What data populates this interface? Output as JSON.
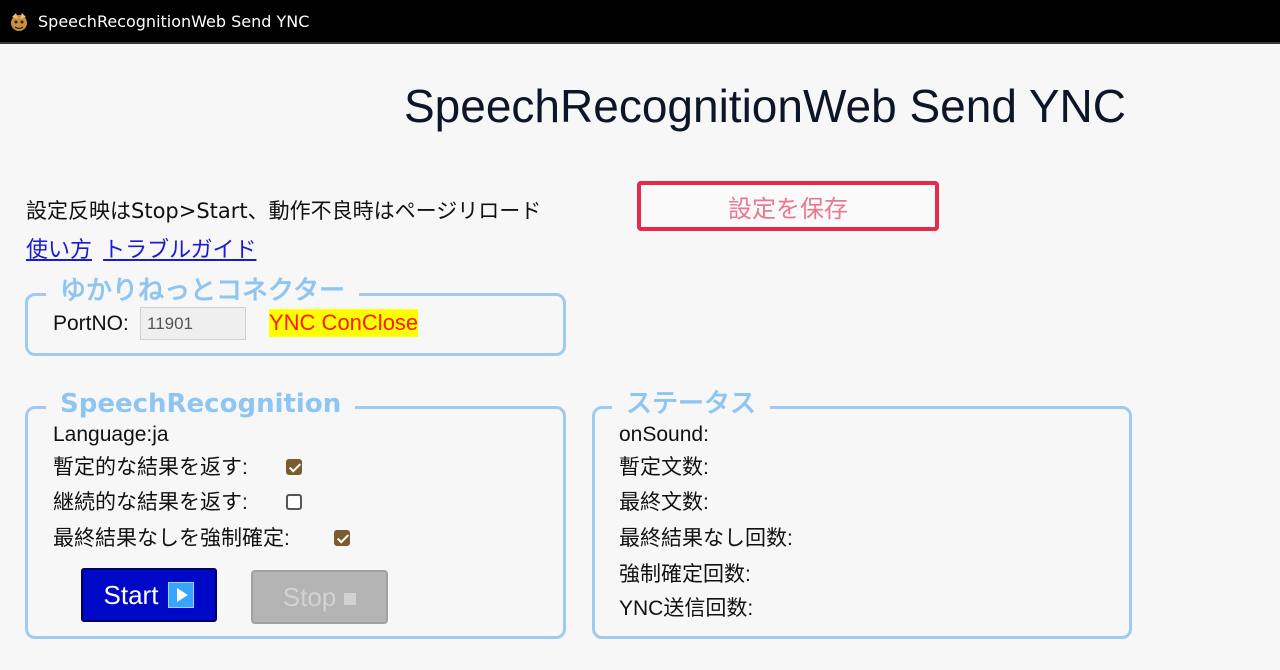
{
  "window": {
    "title": "SpeechRecognitionWeb Send YNC",
    "icon": "app-icon"
  },
  "page": {
    "title": "SpeechRecognitionWeb Send YNC",
    "notice": "設定反映はStop>Start、動作不良時はページリロード",
    "save_label": "設定を保存",
    "links": [
      "使い方",
      "トラブルガイド"
    ]
  },
  "ync": {
    "legend": "ゆかりねっとコネクター",
    "port_label": "PortNO:",
    "port_value": "11901",
    "connection_status": "YNC ConClose"
  },
  "speech": {
    "legend": "SpeechRecognition",
    "language": "Language:ja",
    "options": [
      {
        "label": "暫定的な結果を返す:",
        "checked": true
      },
      {
        "label": "継続的な結果を返す:",
        "checked": false
      },
      {
        "label": "最終結果なしを強制確定:",
        "checked": true
      }
    ],
    "start_label": "Start",
    "stop_label": "Stop"
  },
  "status": {
    "legend": "ステータス",
    "items": [
      "onSound:",
      "暫定文数:",
      "最終文数:",
      "最終結果なし回数:",
      "強制確定回数:",
      "YNC送信回数:"
    ]
  },
  "colors": {
    "save_border": "#e52a4c",
    "panel_border": "#9ecbf2",
    "legend_text": "#8ec5f2",
    "start_bg": "#0008c8",
    "status_highlight": "#ffff00",
    "status_text": "#ff1a00"
  }
}
